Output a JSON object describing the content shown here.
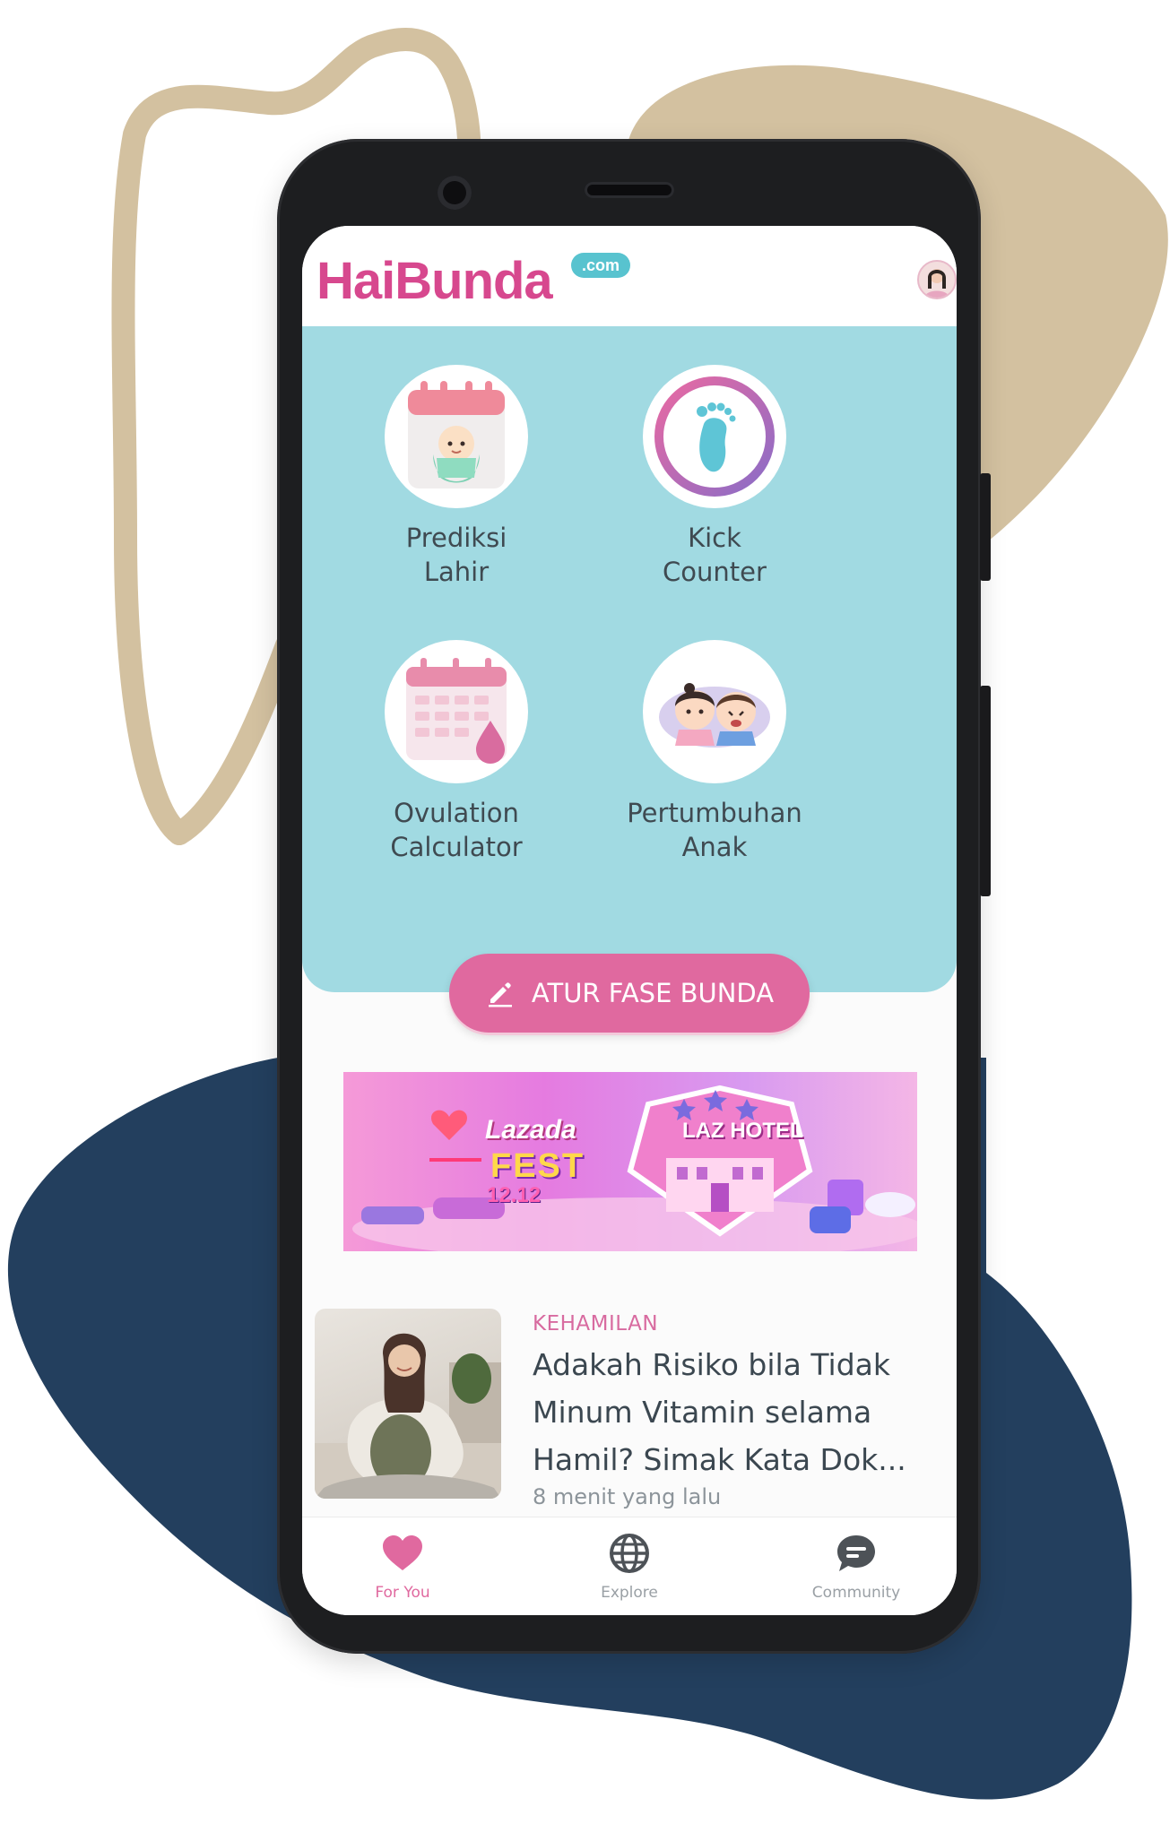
{
  "app": {
    "logo_text": "HaiBunda",
    "logo_badge": ".com"
  },
  "tools": [
    {
      "label": "Prediksi\nLahir",
      "icon": "baby-calendar-icon"
    },
    {
      "label": "Kick\nCounter",
      "icon": "footprint-icon"
    },
    {
      "label": "Ovulation\nCalculator",
      "icon": "ovulation-calendar-icon"
    },
    {
      "label": "Pertumbuhan\nAnak",
      "icon": "children-icon"
    }
  ],
  "cta": {
    "label": "ATUR FASE BUNDA",
    "icon": "pencil-icon"
  },
  "banner": {
    "brand": "Lazada",
    "fest": "FEST",
    "date": "12.12",
    "hotel": "LAZ HOTEL"
  },
  "article": {
    "category": "KEHAMILAN",
    "title": "Adakah Risiko bila Tidak Minum Vitamin selama Hamil? Simak Kata Dok...",
    "time": "8 menit yang lalu"
  },
  "nav": [
    {
      "label": "For You",
      "icon": "heart-icon",
      "active": true
    },
    {
      "label": "Explore",
      "icon": "globe-icon",
      "active": false
    },
    {
      "label": "Community",
      "icon": "chat-bubble-icon",
      "active": false
    }
  ],
  "colors": {
    "brand_pink": "#d7488e",
    "teal_panel": "#a1dae2",
    "cta_pink": "#e0699f",
    "beige_shape": "#d3c1a0",
    "navy_shape": "#233f5e"
  }
}
